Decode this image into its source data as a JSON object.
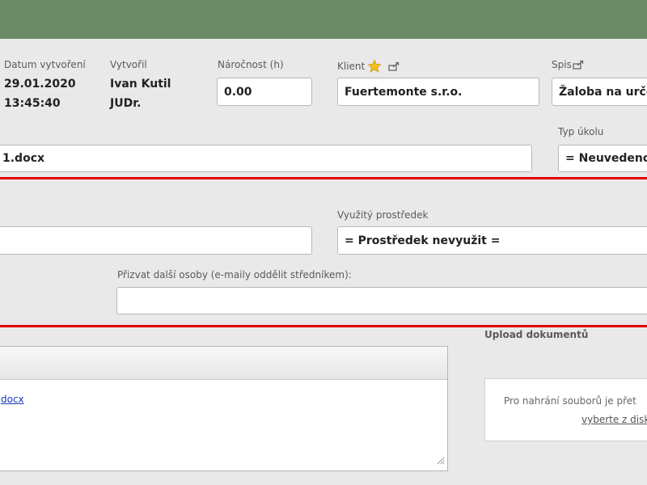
{
  "header": {
    "datum_label": "Datum vytvoření",
    "datum_date": "29.01.2020",
    "datum_time": "13:45:40",
    "vytvoril_label": "Vytvořil",
    "vytvoril_name1": "Ivan Kutil",
    "vytvoril_name2": "JUDr.",
    "narocnost_label": "Náročnost (h)",
    "narocnost_value": "0.00",
    "klient_label": "Klient",
    "klient_value": "Fuertemonte s.r.o.",
    "spis_label": "Spis",
    "spis_value": "Žaloba na urče"
  },
  "task": {
    "name_value": "1.docx",
    "typ_ukolu_label": "Typ úkolu",
    "typ_ukolu_value": "= Neuvedeno"
  },
  "resources": {
    "prostredek_label": "Využitý prostředek",
    "prostredek_value": "= Prostředek nevyužit ="
  },
  "invite": {
    "label": "Přizvat další osoby (e-maily oddělit středníkem):",
    "value": ""
  },
  "attachments": {
    "file_link": "docx"
  },
  "upload": {
    "label": "Upload dokumentů",
    "line1": "Pro nahrání souborů je přet",
    "line2": "vyberte z disk"
  },
  "colors": {
    "topbar": "#6a8b65",
    "accent_red": "#e10000",
    "link": "#1a37c4"
  }
}
